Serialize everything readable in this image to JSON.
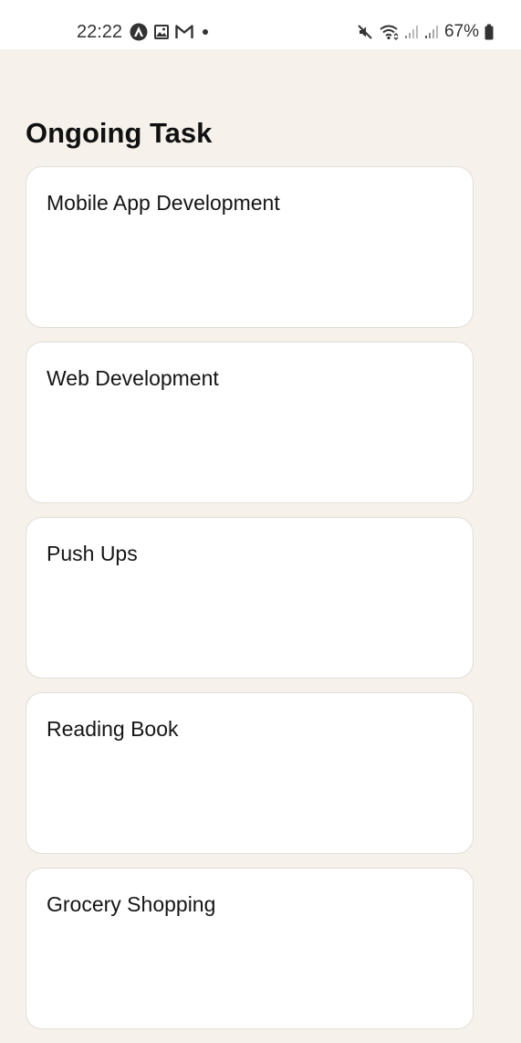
{
  "status_bar": {
    "time": "22:22",
    "left_icons": [
      "app-notification-icon",
      "gallery-icon",
      "gmail-icon",
      "more-dot-icon"
    ],
    "right_icons": [
      "mute-icon",
      "wifi-icon",
      "signal-1-icon",
      "signal-2-icon",
      "battery-icon"
    ],
    "battery": "67%"
  },
  "page": {
    "title": "Ongoing Task"
  },
  "tasks": [
    {
      "title": "Mobile App Development"
    },
    {
      "title": "Web Development"
    },
    {
      "title": "Push Ups"
    },
    {
      "title": "Reading Book"
    },
    {
      "title": "Grocery Shopping"
    }
  ],
  "colors": {
    "background": "#f6f1eb",
    "card": "#ffffff",
    "card_border": "#e2ddd6",
    "text": "#111111"
  }
}
